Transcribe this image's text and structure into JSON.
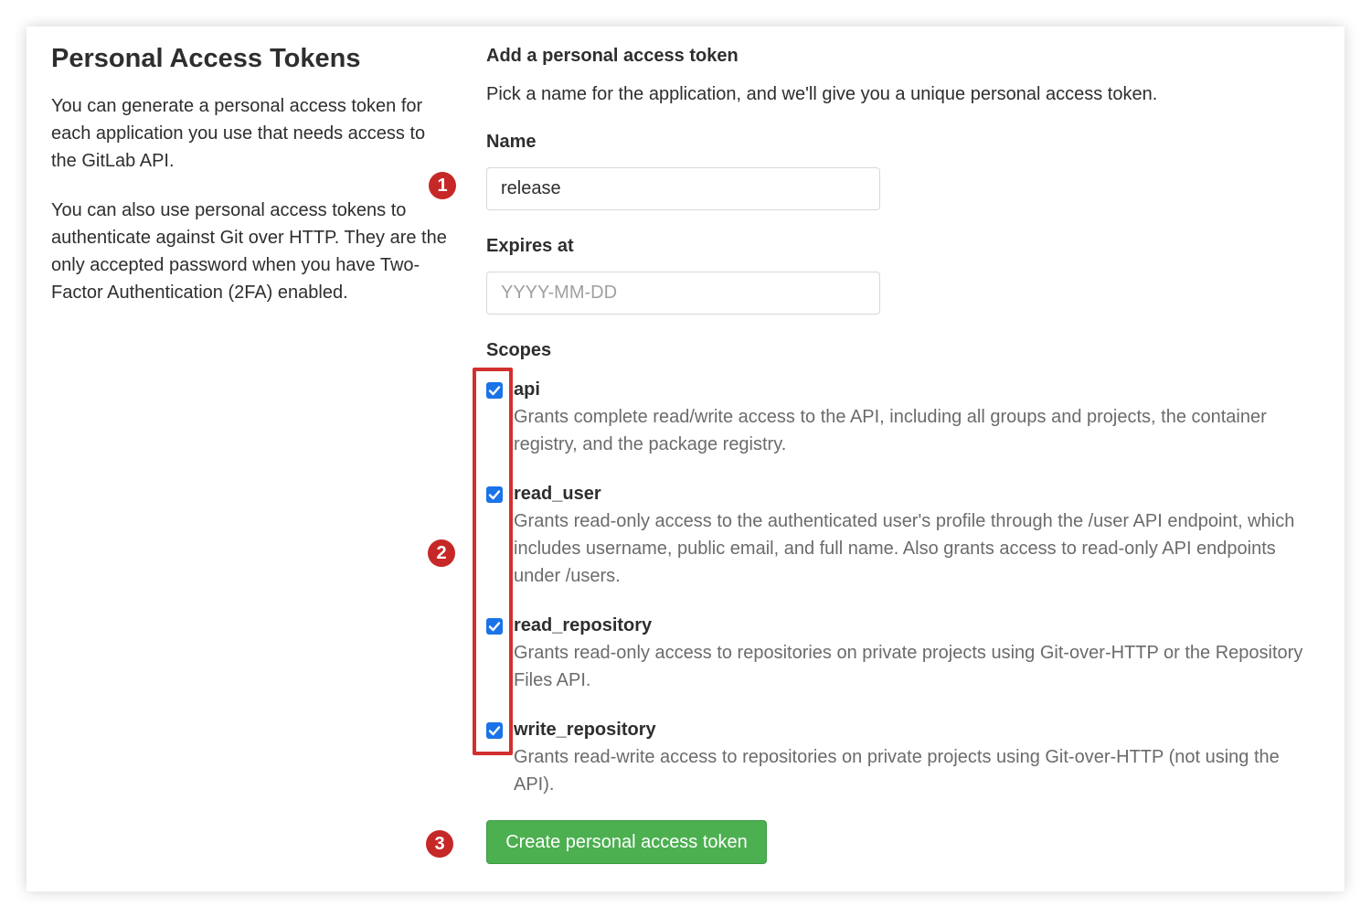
{
  "left_panel": {
    "title": "Personal Access Tokens",
    "paragraph1": "You can generate a personal access token for each application you use that needs access to the GitLab API.",
    "paragraph2": "You can also use personal access tokens to authenticate against Git over HTTP. They are the only accepted password when you have Two-Factor Authentication (2FA) enabled."
  },
  "form": {
    "title": "Add a personal access token",
    "description": "Pick a name for the application, and we'll give you a unique personal access token.",
    "name_label": "Name",
    "name_value": "release",
    "expires_label": "Expires at",
    "expires_placeholder": "YYYY-MM-DD",
    "scopes_label": "Scopes",
    "scopes": [
      {
        "name": "api",
        "checked": true,
        "description": "Grants complete read/write access to the API, including all groups and projects, the container registry, and the package registry."
      },
      {
        "name": "read_user",
        "checked": true,
        "description": "Grants read-only access to the authenticated user's profile through the /user API endpoint, which includes username, public email, and full name. Also grants access to read-only API endpoints under /users."
      },
      {
        "name": "read_repository",
        "checked": true,
        "description": "Grants read-only access to repositories on private projects using Git-over-HTTP or the Repository Files API."
      },
      {
        "name": "write_repository",
        "checked": true,
        "description": "Grants read-write access to repositories on private projects using Git-over-HTTP (not using the API)."
      }
    ],
    "submit_label": "Create personal access token"
  },
  "annotations": {
    "marker1": "1",
    "marker2": "2",
    "marker3": "3",
    "marker_color": "#c62828",
    "highlight_color": "#d32f2f"
  },
  "colors": {
    "button_green": "#4caf50",
    "checkbox_blue": "#1a73e8"
  }
}
